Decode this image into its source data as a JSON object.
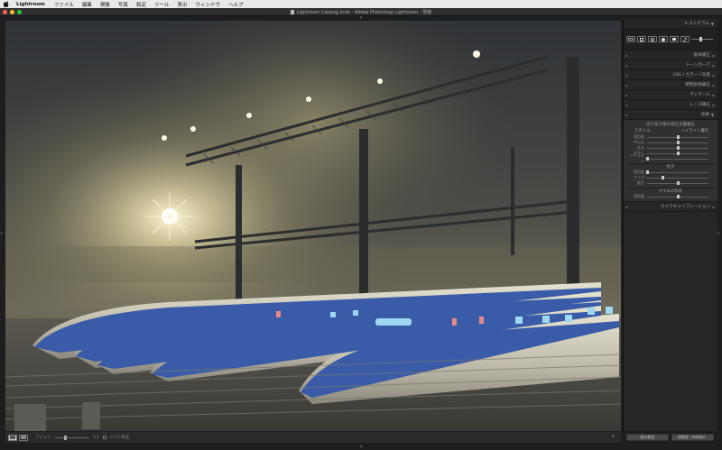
{
  "menubar": {
    "app_name": "Lightroom",
    "items": [
      "ファイル",
      "編集",
      "現像",
      "写真",
      "設定",
      "ツール",
      "表示",
      "ウィンドウ",
      "ヘルプ"
    ]
  },
  "window": {
    "title": "Lightroom Catalog.lrcat - Adobe Photoshop Lightroom - 現像"
  },
  "right_panel": {
    "histogram_label": "ヒストグラム",
    "sections": [
      {
        "label": "基本補正"
      },
      {
        "label": "トーンカーブ"
      },
      {
        "label": "HSL / カラー / 白黒"
      },
      {
        "label": "明暗別色補正"
      },
      {
        "label": "ディテール"
      },
      {
        "label": "レンズ補正"
      }
    ],
    "effects": {
      "label": "効果",
      "vignette_title": "切り抜き後の周辺光量補正",
      "style_label": "スタイル：",
      "style_value": "ハイライト優先",
      "vignette_sliders": [
        {
          "label": "適用量",
          "value": 0.5
        },
        {
          "label": "中心点",
          "value": 0.5
        },
        {
          "label": "丸み",
          "value": 0.5
        },
        {
          "label": "ぼかし",
          "value": 0.5
        },
        {
          "label": "ハイライト",
          "value": 0.0
        }
      ],
      "grain_title": "粒子",
      "grain_sliders": [
        {
          "label": "適用量",
          "value": 0.0
        },
        {
          "label": "サイズ",
          "value": 0.25
        },
        {
          "label": "粗さ",
          "value": 0.5
        }
      ],
      "haze_title": "かすみの除去",
      "haze_sliders": [
        {
          "label": "適用量",
          "value": 0.5
        }
      ]
    },
    "camera_calibration_label": "カメラキャリブレーション",
    "buttons": {
      "previous": "前の設定",
      "reset": "初期化（Adobe）"
    }
  },
  "toolbar": {
    "zoom_left": "フィット",
    "zoom_right": "1:1",
    "soft_proof": "ソフト校正"
  },
  "colors": {
    "accent_red": "#ff5f57",
    "accent_yellow": "#febc2e",
    "accent_green": "#28c840"
  }
}
